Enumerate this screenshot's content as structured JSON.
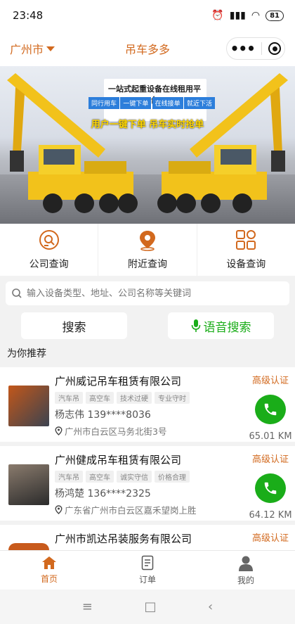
{
  "status_bar": {
    "time": "23:48",
    "battery": "81"
  },
  "nav": {
    "city": "广州市",
    "title": "吊车多多"
  },
  "banner": {
    "heading": "一站式起重设备在线租用平台",
    "tags": [
      "同行用车",
      "一键下单",
      "在线接单",
      "就近下活"
    ],
    "slogan": "用户一键下单  吊车实时抢单"
  },
  "quick": [
    {
      "label": "公司查询",
      "icon": "company-search-icon"
    },
    {
      "label": "附近查询",
      "icon": "location-pin-icon"
    },
    {
      "label": "设备查询",
      "icon": "grid-icon"
    }
  ],
  "search": {
    "placeholder": "输入设备类型、地址、公司名称等关键词",
    "search_label": "搜索",
    "voice_label": "语音搜索"
  },
  "section_title": "为你推荐",
  "companies": [
    {
      "name": "广州威记吊车租赁有限公司",
      "tags": [
        "汽车吊",
        "高空车",
        "技术过硬",
        "专业守时"
      ],
      "contact": "杨志伟  139****8036",
      "address": "广州市白云区马务北街3号",
      "cert": "高级认证",
      "distance": "65.01 KM"
    },
    {
      "name": "广州健成吊车租赁有限公司",
      "tags": [
        "汽车吊",
        "高空车",
        "诚实守信",
        "价格合理"
      ],
      "contact": "杨鸿楚  136****2325",
      "address": "广东省广州市白云区嘉禾望岗上胜",
      "cert": "高级认证",
      "distance": "64.12 KM"
    },
    {
      "name": "广州市凯达吊装服务有限公司",
      "cert": "高级认证"
    }
  ],
  "tabbar": [
    {
      "label": "首页",
      "icon": "home-icon"
    },
    {
      "label": "订单",
      "icon": "order-icon"
    },
    {
      "label": "我的",
      "icon": "profile-icon"
    }
  ],
  "colors": {
    "accent": "#d2691e",
    "green": "#1aad19"
  }
}
